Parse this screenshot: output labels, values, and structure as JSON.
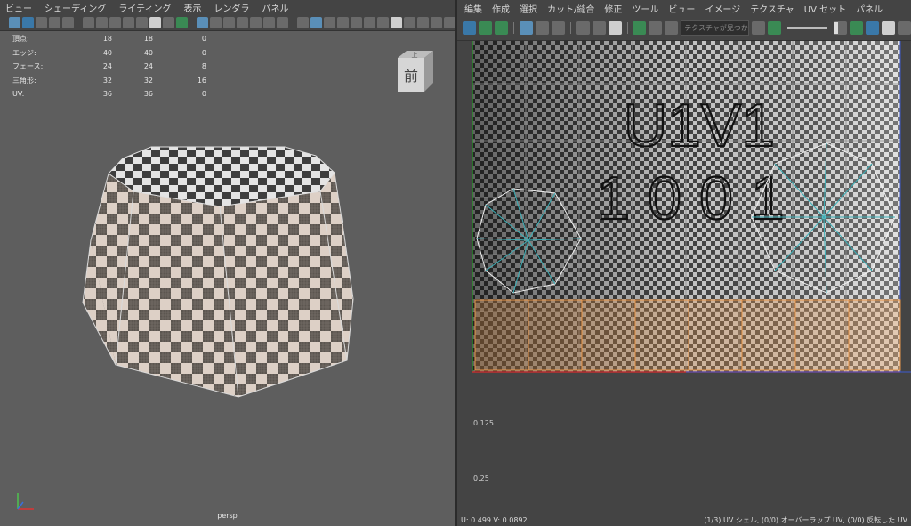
{
  "viewport": {
    "menu": [
      "ビュー",
      "シェーディング",
      "ライティング",
      "表示",
      "レンダラ",
      "パネル"
    ],
    "hud": [
      {
        "label": "頂点:",
        "a": "18",
        "b": "18",
        "c": "0"
      },
      {
        "label": "エッジ:",
        "a": "40",
        "b": "40",
        "c": "0"
      },
      {
        "label": "フェース:",
        "a": "24",
        "b": "24",
        "c": "8"
      },
      {
        "label": "三角形:",
        "a": "32",
        "b": "32",
        "c": "16"
      },
      {
        "label": "UV:",
        "a": "36",
        "b": "36",
        "c": "0"
      }
    ],
    "viewcube": {
      "top": "上",
      "front": "前"
    },
    "camera": "persp"
  },
  "uv_editor": {
    "menu": [
      "編集",
      "作成",
      "選択",
      "カット/縫合",
      "修正",
      "ツール",
      "ビュー",
      "イメージ",
      "テクスチャ",
      "UV セット",
      "パネル"
    ],
    "search_placeholder": "テクスチャが見つかり...",
    "tile_label_1": "U1V1",
    "tile_label_2": "1001",
    "ruler": [
      "0.125",
      "0.25"
    ],
    "status_left": "U:  0.499 V:  0.0892",
    "status_right": "(1/3) UV シェル, (0/0) オーバーラップ UV, (0/0) 反転した UV"
  },
  "colors": {
    "accent_blue": "#5a8fb8",
    "uv_outline": "#e8e8e8",
    "uv_spokes": "#3ab0b8",
    "selection": "#e8964a"
  }
}
